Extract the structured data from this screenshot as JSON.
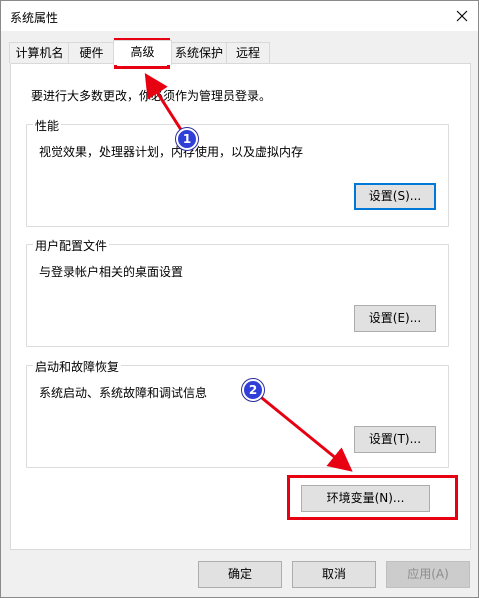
{
  "window": {
    "title": "系统属性"
  },
  "tabs": [
    {
      "label": "计算机名"
    },
    {
      "label": "硬件"
    },
    {
      "label": "高级"
    },
    {
      "label": "系统保护"
    },
    {
      "label": "远程"
    }
  ],
  "intro": "要进行大多数更改，你必须作为管理员登录。",
  "groups": {
    "performance": {
      "title": "性能",
      "desc": "视觉效果，处理器计划，内存使用，以及虚拟内存",
      "button": "设置(S)..."
    },
    "profile": {
      "title": "用户配置文件",
      "desc": "与登录帐户相关的桌面设置",
      "button": "设置(E)..."
    },
    "startup": {
      "title": "启动和故障恢复",
      "desc": "系统启动、系统故障和调试信息",
      "button": "设置(T)..."
    }
  },
  "env_button": "环境变量(N)...",
  "footer": {
    "ok": "确定",
    "cancel": "取消",
    "apply": "应用(A)"
  },
  "annotations": {
    "badge1": "1",
    "badge2": "2",
    "color": "#e60012"
  },
  "icons": {
    "close": "close-icon"
  }
}
